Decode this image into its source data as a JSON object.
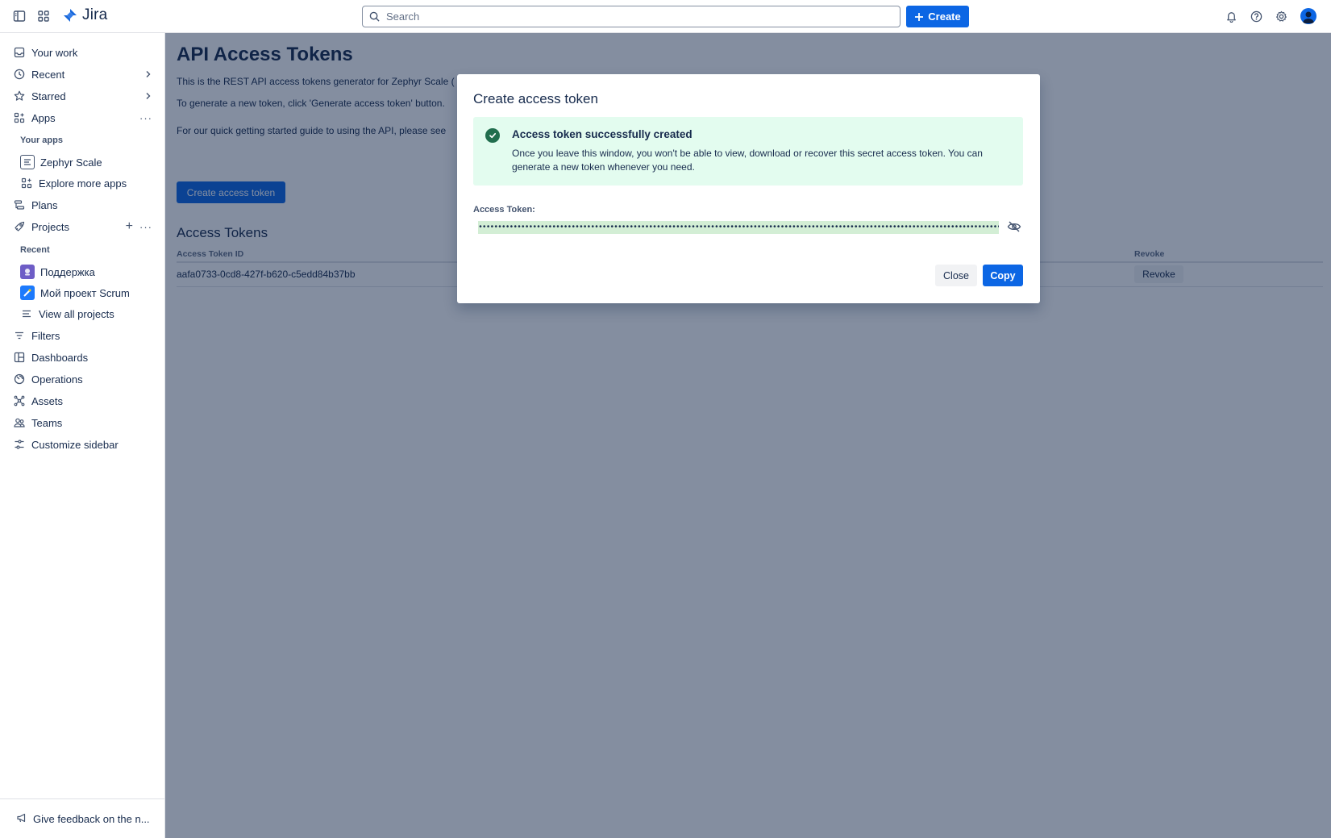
{
  "topbar": {
    "app_name": "Jira",
    "search_placeholder": "Search",
    "create_label": "Create"
  },
  "sidebar": {
    "your_work": "Your work",
    "recent": "Recent",
    "starred": "Starred",
    "apps": "Apps",
    "your_apps_label": "Your apps",
    "zephyr_scale": "Zephyr Scale",
    "explore_more_apps": "Explore more apps",
    "plans": "Plans",
    "projects": "Projects",
    "recent_label": "Recent",
    "project_1": "Поддержка",
    "project_2": "Мой проект Scrum",
    "view_all_projects": "View all projects",
    "filters": "Filters",
    "dashboards": "Dashboards",
    "operations": "Operations",
    "assets": "Assets",
    "teams": "Teams",
    "customize_sidebar": "Customize sidebar",
    "feedback": "Give feedback on the n..."
  },
  "main": {
    "title": "API Access Tokens",
    "para1": "This is the REST API access tokens generator for Zephyr Scale (",
    "para2": "To generate a new token, click 'Generate access token' button.",
    "para3": "For our quick getting started guide to using the API, please see",
    "create_button": "Create access token",
    "section_title": "Access Tokens",
    "table": {
      "col_id": "Access Token ID",
      "col_revoke": "Revoke",
      "rows": [
        {
          "id": "aafa0733-0cd8-427f-b620-c5edd84b37bb",
          "revoke": "Revoke"
        }
      ]
    }
  },
  "modal": {
    "title": "Create access token",
    "success_title": "Access token successfully created",
    "success_text": "Once you leave this window, you won't be able to view, download or recover this secret access token. You can generate a new token whenever you need.",
    "token_label": "Access Token:",
    "token_value": "•••••••••••••••••••••••••••••••••••••••••••••••••••••••••••••••••••••••••••••••••••••••••••••••••••••••••••••••••••••••••••••••••••••••••••••••••••••",
    "close_label": "Close",
    "copy_label": "Copy"
  },
  "colors": {
    "brand_blue": "#0c66e4",
    "success_bg": "#e3fcef",
    "success_icon": "#216e4e",
    "overlay": "rgba(9,30,66,0.5)"
  }
}
